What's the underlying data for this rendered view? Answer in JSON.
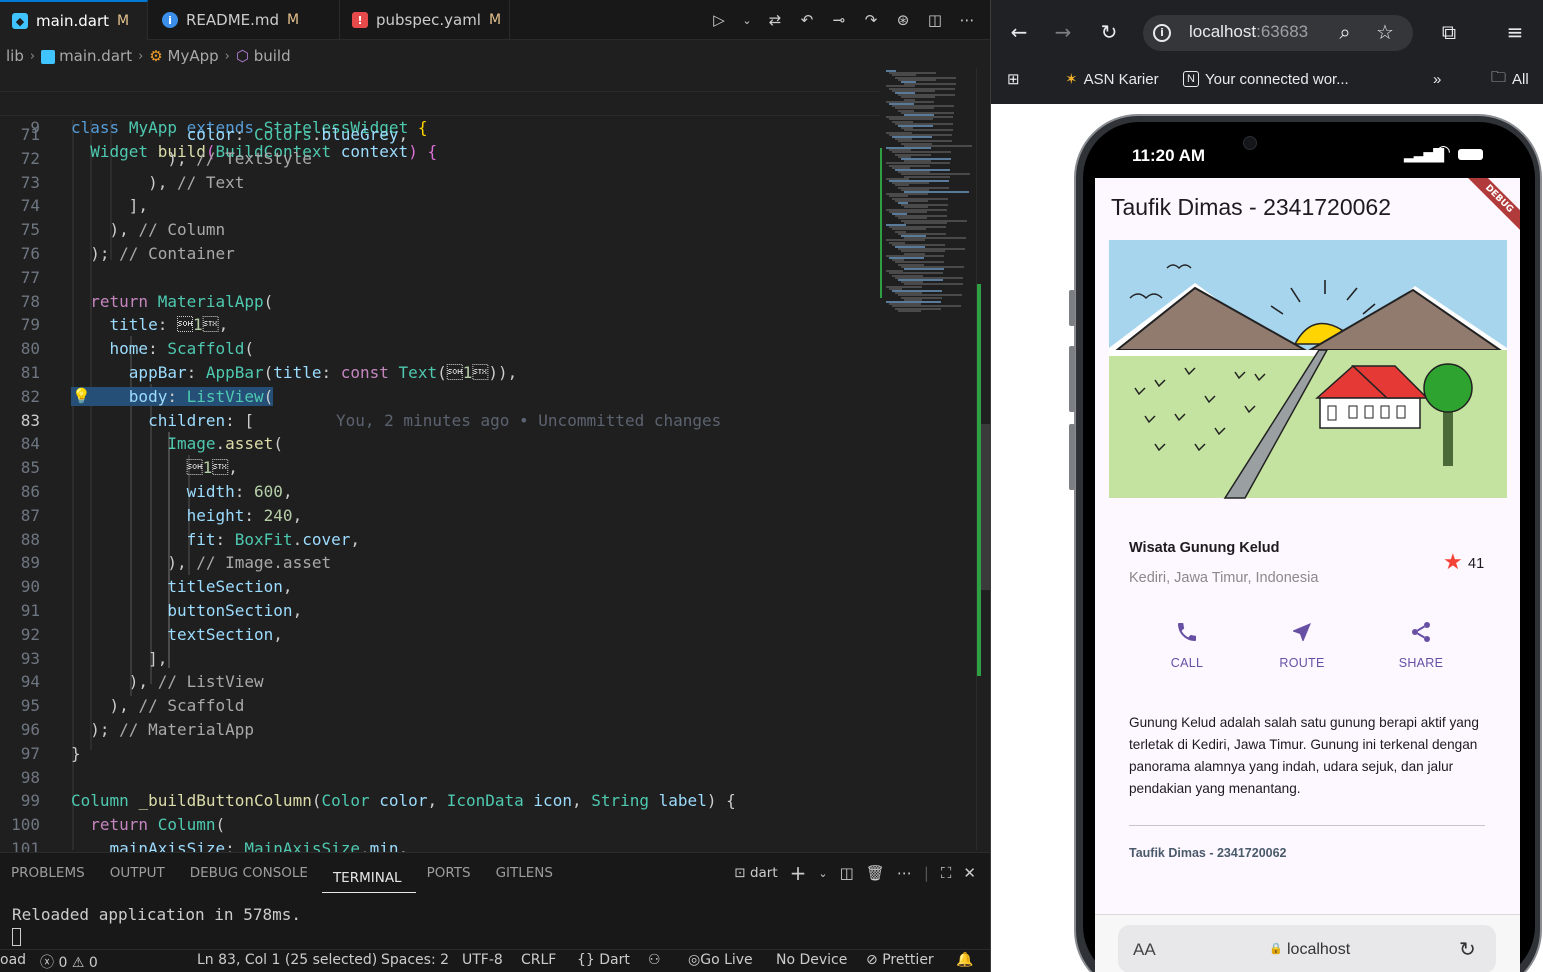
{
  "editor": {
    "tabs": [
      {
        "label": "main.dart",
        "mod": "M",
        "icon": "dart-icon"
      },
      {
        "label": "README.md",
        "mod": "M",
        "icon": "info-icon"
      },
      {
        "label": "pubspec.yaml",
        "mod": "M",
        "icon": "yaml-icon"
      }
    ],
    "breadcrumb": [
      "lib",
      "main.dart",
      "MyApp",
      "build"
    ],
    "sticky": [
      {
        "num": "5",
        "text": "class MyApp extends StatelessWidget {"
      },
      {
        "num": "9",
        "text": "  Widget build(BuildContext context) {"
      }
    ],
    "lines": [
      {
        "num": "71",
        "text": "            color: Colors.blueGrey,"
      },
      {
        "num": "72",
        "text": "          ), // TextStyle"
      },
      {
        "num": "73",
        "text": "        ), // Text"
      },
      {
        "num": "74",
        "text": "      ],"
      },
      {
        "num": "75",
        "text": "    ), // Column"
      },
      {
        "num": "76",
        "text": "  ); // Container"
      },
      {
        "num": "77",
        "text": ""
      },
      {
        "num": "78",
        "text": "  return MaterialApp("
      },
      {
        "num": "79",
        "text": "    title: 'Taufik Dimas - 2341720062',"
      },
      {
        "num": "80",
        "text": "    home: Scaffold("
      },
      {
        "num": "81",
        "text": "      appBar: AppBar(title: const Text('Taufik Dimas - 2341720062')),"
      },
      {
        "num": "82",
        "text": "      body: ListView("
      },
      {
        "num": "83",
        "text": "        children: ["
      },
      {
        "num": "84",
        "text": "          Image.asset("
      },
      {
        "num": "85",
        "text": "            'images/gunung.png',"
      },
      {
        "num": "86",
        "text": "            width: 600,"
      },
      {
        "num": "87",
        "text": "            height: 240,"
      },
      {
        "num": "88",
        "text": "            fit: BoxFit.cover,"
      },
      {
        "num": "89",
        "text": "          ), // Image.asset"
      },
      {
        "num": "90",
        "text": "          titleSection,"
      },
      {
        "num": "91",
        "text": "          buttonSection,"
      },
      {
        "num": "92",
        "text": "          textSection,"
      },
      {
        "num": "93",
        "text": "        ],"
      },
      {
        "num": "94",
        "text": "      ), // ListView"
      },
      {
        "num": "95",
        "text": "    ), // Scaffold"
      },
      {
        "num": "96",
        "text": "  ); // MaterialApp"
      },
      {
        "num": "97",
        "text": "}"
      },
      {
        "num": "98",
        "text": ""
      },
      {
        "num": "99",
        "text": "Column _buildButtonColumn(Color color, IconData icon, String label) {"
      },
      {
        "num": "100",
        "text": "  return Column("
      },
      {
        "num": "101",
        "text": "    mainAxisSize: MainAxisSize.min,"
      }
    ],
    "blame": "You, 2 minutes ago • Uncommitted changes"
  },
  "panel": {
    "tabs": [
      "PROBLEMS",
      "OUTPUT",
      "DEBUG CONSOLE",
      "TERMINAL",
      "PORTS",
      "GITLENS"
    ],
    "active_tab": "TERMINAL",
    "terminal_name": "dart",
    "terminal_output": "Reloaded application in 578ms."
  },
  "statusbar": {
    "left_cut": "oad",
    "errors": "0",
    "warnings": "0",
    "position": "Ln 83, Col 1 (25 selected)",
    "spaces": "Spaces: 2",
    "encoding": "UTF-8",
    "eol": "CRLF",
    "language": "Dart",
    "go_live": "Go Live",
    "device": "No Device",
    "prettier": "Prettier"
  },
  "browser": {
    "url_host": "localhost",
    "url_port": ":63683",
    "bookmarks": [
      "ASN Karier",
      "Your connected wor...",
      "All"
    ],
    "phone_time": "11:20 AM",
    "app": {
      "appbar_title": "Taufik Dimas - 2341720062",
      "debug_banner": "DEBUG",
      "title": "Wisata Gunung Kelud",
      "location": "Kediri, Jawa Timur, Indonesia",
      "rating_count": "41",
      "buttons": [
        "CALL",
        "ROUTE",
        "SHARE"
      ],
      "description": "Gunung Kelud adalah salah satu gunung berapi aktif yang terletak di Kediri, Jawa Timur. Gunung ini terkenal dengan panorama alamnya yang indah, udara sejuk, dan jalur pendakian yang menantang.",
      "footer": "Taufik Dimas - 2341720062"
    },
    "safari_aa": "AA",
    "safari_url": "localhost"
  },
  "colors": {
    "accent": "#0078d4",
    "flutter_primary": "#6750a4",
    "star": "#f44336"
  }
}
